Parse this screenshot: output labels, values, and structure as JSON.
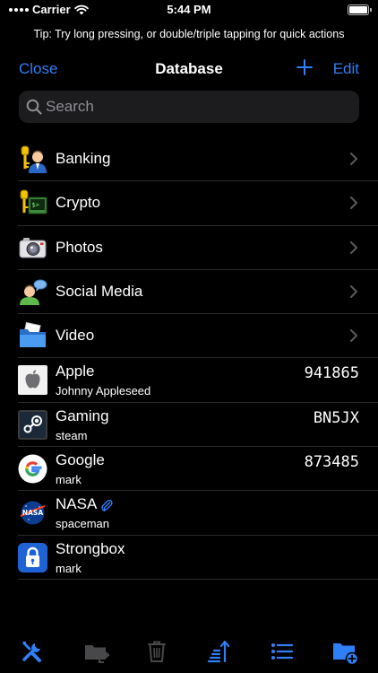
{
  "status": {
    "carrier": "Carrier",
    "time": "5:44 PM"
  },
  "tip": "Tip: Try long pressing, or double/triple tapping for quick actions",
  "nav": {
    "close": "Close",
    "title": "Database",
    "edit": "Edit"
  },
  "search": {
    "placeholder": "Search"
  },
  "groups": [
    {
      "label": "Banking",
      "icon": "banking-icon"
    },
    {
      "label": "Crypto",
      "icon": "crypto-icon"
    },
    {
      "label": "Photos",
      "icon": "camera-icon"
    },
    {
      "label": "Social Media",
      "icon": "social-icon"
    },
    {
      "label": "Video",
      "icon": "folder-icon"
    }
  ],
  "entries": [
    {
      "title": "Apple",
      "username": "Johnny Appleseed",
      "code": "941865",
      "icon": "apple-icon"
    },
    {
      "title": "Gaming",
      "username": "steam",
      "code": "BN5JX",
      "icon": "steam-icon"
    },
    {
      "title": "Google",
      "username": "mark",
      "code": "873485",
      "icon": "google-icon"
    },
    {
      "title": "NASA",
      "username": "spaceman",
      "code": "",
      "icon": "nasa-icon",
      "attachment": true
    },
    {
      "title": "Strongbox",
      "username": "mark",
      "code": "",
      "icon": "strongbox-icon"
    }
  ],
  "toolbar": [
    "settings-icon",
    "move-folder-icon",
    "trash-icon",
    "sort-icon",
    "list-icon",
    "new-folder-icon"
  ],
  "colors": {
    "accent": "#2f7ff6",
    "background": "#000000",
    "separator": "#2a2a2c"
  }
}
